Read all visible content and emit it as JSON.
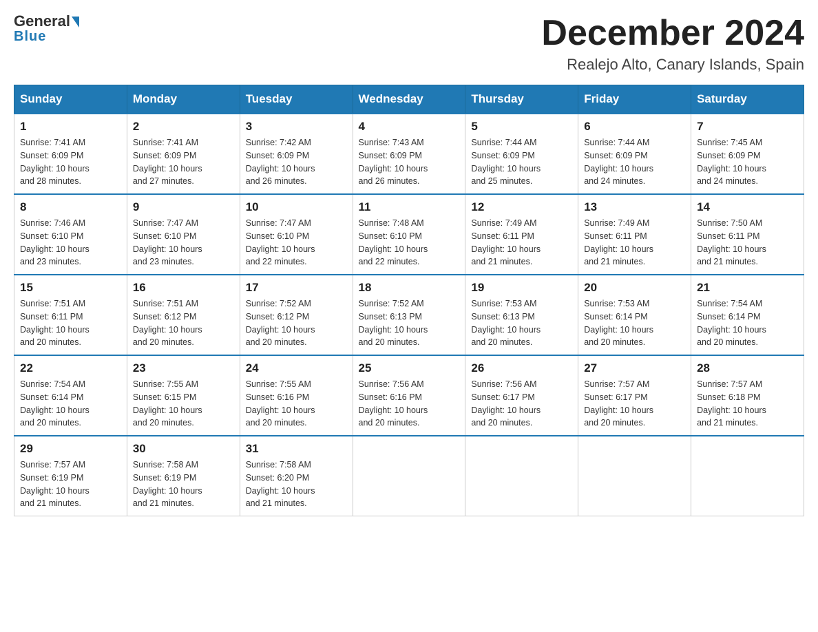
{
  "logo": {
    "general": "General",
    "blue": "Blue"
  },
  "header": {
    "month": "December 2024",
    "location": "Realejo Alto, Canary Islands, Spain"
  },
  "weekdays": [
    "Sunday",
    "Monday",
    "Tuesday",
    "Wednesday",
    "Thursday",
    "Friday",
    "Saturday"
  ],
  "weeks": [
    [
      {
        "day": 1,
        "sunrise": "7:41 AM",
        "sunset": "6:09 PM",
        "daylight": "10 hours and 28 minutes."
      },
      {
        "day": 2,
        "sunrise": "7:41 AM",
        "sunset": "6:09 PM",
        "daylight": "10 hours and 27 minutes."
      },
      {
        "day": 3,
        "sunrise": "7:42 AM",
        "sunset": "6:09 PM",
        "daylight": "10 hours and 26 minutes."
      },
      {
        "day": 4,
        "sunrise": "7:43 AM",
        "sunset": "6:09 PM",
        "daylight": "10 hours and 26 minutes."
      },
      {
        "day": 5,
        "sunrise": "7:44 AM",
        "sunset": "6:09 PM",
        "daylight": "10 hours and 25 minutes."
      },
      {
        "day": 6,
        "sunrise": "7:44 AM",
        "sunset": "6:09 PM",
        "daylight": "10 hours and 24 minutes."
      },
      {
        "day": 7,
        "sunrise": "7:45 AM",
        "sunset": "6:09 PM",
        "daylight": "10 hours and 24 minutes."
      }
    ],
    [
      {
        "day": 8,
        "sunrise": "7:46 AM",
        "sunset": "6:10 PM",
        "daylight": "10 hours and 23 minutes."
      },
      {
        "day": 9,
        "sunrise": "7:47 AM",
        "sunset": "6:10 PM",
        "daylight": "10 hours and 23 minutes."
      },
      {
        "day": 10,
        "sunrise": "7:47 AM",
        "sunset": "6:10 PM",
        "daylight": "10 hours and 22 minutes."
      },
      {
        "day": 11,
        "sunrise": "7:48 AM",
        "sunset": "6:10 PM",
        "daylight": "10 hours and 22 minutes."
      },
      {
        "day": 12,
        "sunrise": "7:49 AM",
        "sunset": "6:11 PM",
        "daylight": "10 hours and 21 minutes."
      },
      {
        "day": 13,
        "sunrise": "7:49 AM",
        "sunset": "6:11 PM",
        "daylight": "10 hours and 21 minutes."
      },
      {
        "day": 14,
        "sunrise": "7:50 AM",
        "sunset": "6:11 PM",
        "daylight": "10 hours and 21 minutes."
      }
    ],
    [
      {
        "day": 15,
        "sunrise": "7:51 AM",
        "sunset": "6:11 PM",
        "daylight": "10 hours and 20 minutes."
      },
      {
        "day": 16,
        "sunrise": "7:51 AM",
        "sunset": "6:12 PM",
        "daylight": "10 hours and 20 minutes."
      },
      {
        "day": 17,
        "sunrise": "7:52 AM",
        "sunset": "6:12 PM",
        "daylight": "10 hours and 20 minutes."
      },
      {
        "day": 18,
        "sunrise": "7:52 AM",
        "sunset": "6:13 PM",
        "daylight": "10 hours and 20 minutes."
      },
      {
        "day": 19,
        "sunrise": "7:53 AM",
        "sunset": "6:13 PM",
        "daylight": "10 hours and 20 minutes."
      },
      {
        "day": 20,
        "sunrise": "7:53 AM",
        "sunset": "6:14 PM",
        "daylight": "10 hours and 20 minutes."
      },
      {
        "day": 21,
        "sunrise": "7:54 AM",
        "sunset": "6:14 PM",
        "daylight": "10 hours and 20 minutes."
      }
    ],
    [
      {
        "day": 22,
        "sunrise": "7:54 AM",
        "sunset": "6:14 PM",
        "daylight": "10 hours and 20 minutes."
      },
      {
        "day": 23,
        "sunrise": "7:55 AM",
        "sunset": "6:15 PM",
        "daylight": "10 hours and 20 minutes."
      },
      {
        "day": 24,
        "sunrise": "7:55 AM",
        "sunset": "6:16 PM",
        "daylight": "10 hours and 20 minutes."
      },
      {
        "day": 25,
        "sunrise": "7:56 AM",
        "sunset": "6:16 PM",
        "daylight": "10 hours and 20 minutes."
      },
      {
        "day": 26,
        "sunrise": "7:56 AM",
        "sunset": "6:17 PM",
        "daylight": "10 hours and 20 minutes."
      },
      {
        "day": 27,
        "sunrise": "7:57 AM",
        "sunset": "6:17 PM",
        "daylight": "10 hours and 20 minutes."
      },
      {
        "day": 28,
        "sunrise": "7:57 AM",
        "sunset": "6:18 PM",
        "daylight": "10 hours and 21 minutes."
      }
    ],
    [
      {
        "day": 29,
        "sunrise": "7:57 AM",
        "sunset": "6:19 PM",
        "daylight": "10 hours and 21 minutes."
      },
      {
        "day": 30,
        "sunrise": "7:58 AM",
        "sunset": "6:19 PM",
        "daylight": "10 hours and 21 minutes."
      },
      {
        "day": 31,
        "sunrise": "7:58 AM",
        "sunset": "6:20 PM",
        "daylight": "10 hours and 21 minutes."
      },
      null,
      null,
      null,
      null
    ]
  ],
  "labels": {
    "sunrise": "Sunrise:",
    "sunset": "Sunset:",
    "daylight": "Daylight:"
  }
}
